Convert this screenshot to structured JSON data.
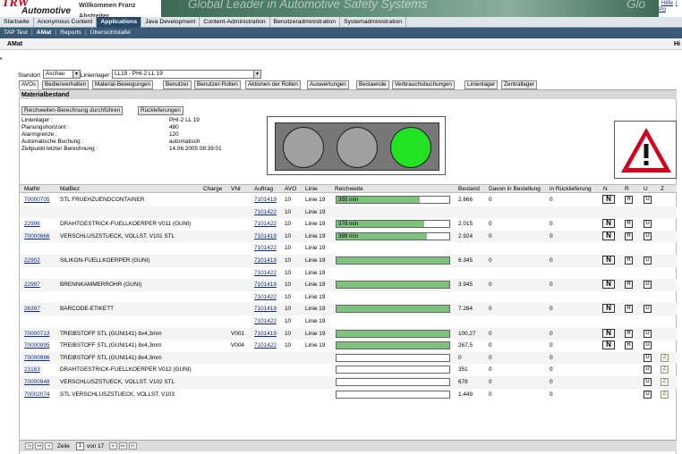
{
  "header": {
    "logo_text": "TRW",
    "logo_sub": "Automotive",
    "welcome": "Willkommen Franz Abstreiter",
    "banner": "Global Leader in Automotive Safety Systems",
    "banner_tail": "Glo",
    "links": [
      "Hilfe",
      "| Po"
    ]
  },
  "nav1": [
    "Startseite",
    "Anonymous Content",
    "Applications",
    "Java Development",
    "Content-Administration",
    "Benutzeradministration",
    "Systemadministration"
  ],
  "nav2": [
    "TAP Test",
    "AMat",
    "Reports",
    "Übersichtstafel"
  ],
  "subheader": {
    "title": "AMat",
    "right": "Hi"
  },
  "filters": {
    "standort_label": "Standort",
    "standort_value": "Aschau",
    "linienlager_label": "Linienlager",
    "linienlager_value": "LL19 - PHI-2 LL 19"
  },
  "tabs": [
    "AVOs",
    "Bedienverhalten",
    "Material-Bewegungen",
    "Benutzer",
    "Benutzer-Rollen",
    "Aktionen der Rollen",
    "Auswertungen",
    "Bestaende",
    "Verbrauchsbuchungen",
    "Linienlager",
    "Zentrallager"
  ],
  "section_title": "Materialbestand",
  "buttons": {
    "reichweite": "Reichweiten-Berechnung durchführen",
    "rueck": "Rückleferungen"
  },
  "info": [
    {
      "k": "Linienlager :",
      "v": "PHI-2 LL 19"
    },
    {
      "k": "Planungshorizont :",
      "v": "480"
    },
    {
      "k": "Alarmgrenze :",
      "v": "120"
    },
    {
      "k": "Automatische Buchung :",
      "v": "automatisch"
    },
    {
      "k": "Zeitpunkt letzter Berechnung :",
      "v": "14.06.2005 08:39:01"
    }
  ],
  "table": {
    "headers": [
      "MatNr",
      "MatBez",
      "Charge",
      "VNr",
      "Auftrag",
      "AVO",
      "Linie",
      "Reichweite",
      "Bestand",
      "Davon in Bestellung",
      "in Rücklieferung",
      "N",
      "R",
      "U",
      "Z"
    ],
    "rows": [
      {
        "matnr": "70000705",
        "matbez": "STL FRUEHZUENDCONTAINER",
        "vnr": "",
        "auftrag": "7101419",
        "avo": "10",
        "linie": "Linie 19",
        "bar": "355 min",
        "fill": 0.74,
        "bestand": "2.666",
        "best": "0",
        "rueck": "0",
        "n": true,
        "r": true,
        "u": true,
        "z": false
      },
      {
        "matnr": "",
        "matbez": "",
        "vnr": "",
        "auftrag": "7101422",
        "avo": "10",
        "linie": "Linie 19",
        "bar": null,
        "fill": 0,
        "bestand": "",
        "best": "",
        "rueck": "",
        "n": false,
        "r": false,
        "u": false,
        "z": false
      },
      {
        "matnr": "22996",
        "matbez": "DRAHTGESTRICK-FUELLKOERPER V011 (GUNI)",
        "vnr": "",
        "auftrag": "7101422",
        "avo": "10",
        "linie": "Linie 19",
        "bar": "378 min",
        "fill": 0.78,
        "bestand": "2.015",
        "best": "0",
        "rueck": "0",
        "n": true,
        "r": true,
        "u": true,
        "z": false
      },
      {
        "matnr": "70000666",
        "matbez": "VERSCHLUSZSTUECK, VOLLST. V101 STL",
        "vnr": "",
        "auftrag": "7101419",
        "avo": "10",
        "linie": "Linie 19",
        "bar": "389 min",
        "fill": 0.8,
        "bestand": "2.924",
        "best": "0",
        "rueck": "0",
        "n": true,
        "r": true,
        "u": true,
        "z": false
      },
      {
        "matnr": "",
        "matbez": "",
        "vnr": "",
        "auftrag": "7101422",
        "avo": "10",
        "linie": "Linie 19",
        "bar": null,
        "fill": 0,
        "bestand": "",
        "best": "",
        "rueck": "",
        "n": false,
        "r": false,
        "u": false,
        "z": false
      },
      {
        "matnr": "22902",
        "matbez": "SILIKON-FUELLKOERPER (GUNI)",
        "vnr": "",
        "auftrag": "7101419",
        "avo": "10",
        "linie": "Linie 19",
        "bar": "",
        "fill": 1,
        "bestand": "6.345",
        "best": "0",
        "rueck": "0",
        "n": true,
        "r": true,
        "u": true,
        "z": false
      },
      {
        "matnr": "",
        "matbez": "",
        "vnr": "",
        "auftrag": "7101422",
        "avo": "10",
        "linie": "Linie 19",
        "bar": null,
        "fill": 0,
        "bestand": "",
        "best": "",
        "rueck": "",
        "n": false,
        "r": false,
        "u": false,
        "z": false
      },
      {
        "matnr": "22997",
        "matbez": "BRENNKAMMERROHR (GUNI)",
        "vnr": "",
        "auftrag": "7101419",
        "avo": "10",
        "linie": "Linie 19",
        "bar": "",
        "fill": 1,
        "bestand": "3.945",
        "best": "0",
        "rueck": "0",
        "n": true,
        "r": true,
        "u": true,
        "z": false
      },
      {
        "matnr": "",
        "matbez": "",
        "vnr": "",
        "auftrag": "7101422",
        "avo": "10",
        "linie": "Linie 19",
        "bar": null,
        "fill": 0,
        "bestand": "",
        "best": "",
        "rueck": "",
        "n": false,
        "r": false,
        "u": false,
        "z": false
      },
      {
        "matnr": "26397",
        "matbez": "BARCODE-ETIKETT",
        "vnr": "",
        "auftrag": "7101419",
        "avo": "10",
        "linie": "Linie 19",
        "bar": "",
        "fill": 1,
        "bestand": "7.264",
        "best": "0",
        "rueck": "0",
        "n": true,
        "r": true,
        "u": true,
        "z": false
      },
      {
        "matnr": "",
        "matbez": "",
        "vnr": "",
        "auftrag": "7101422",
        "avo": "10",
        "linie": "Linie 19",
        "bar": null,
        "fill": 0,
        "bestand": "",
        "best": "",
        "rueck": "",
        "n": false,
        "r": false,
        "u": false,
        "z": false
      },
      {
        "matnr": "70000713",
        "matbez": "TREIBSTOFF STL (GUNI141) 8x4,3mm",
        "vnr": "V001",
        "auftrag": "7101419",
        "avo": "10",
        "linie": "Linie 19",
        "bar": "",
        "fill": 1,
        "bestand": "100,27",
        "best": "0",
        "rueck": "0",
        "n": true,
        "r": true,
        "u": true,
        "z": false
      },
      {
        "matnr": "70000995",
        "matbez": "TREIBSTOFF STL (GUNI141) 8x4,3mm",
        "vnr": "V004",
        "auftrag": "7101422",
        "avo": "10",
        "linie": "Linie 19",
        "bar": "",
        "fill": 1,
        "bestand": "267,5",
        "best": "0",
        "rueck": "0",
        "n": true,
        "r": true,
        "u": true,
        "z": false
      },
      {
        "matnr": "70000996",
        "matbez": "TREIBSTOFF STL (GUNI141) 8x4,3mm",
        "vnr": "",
        "auftrag": "",
        "avo": "",
        "linie": "",
        "bar": "",
        "fill": 0,
        "bestand": "0",
        "best": "0",
        "rueck": "0",
        "n": false,
        "r": false,
        "u": true,
        "z": true
      },
      {
        "matnr": "23163",
        "matbez": "DRAHTGESTRICK-FUELLKOERPER V012 (GUNI)",
        "vnr": "",
        "auftrag": "",
        "avo": "",
        "linie": "",
        "bar": "",
        "fill": 0,
        "bestand": "351",
        "best": "0",
        "rueck": "0",
        "n": false,
        "r": false,
        "u": true,
        "z": true
      },
      {
        "matnr": "70000948",
        "matbez": "VERSCHLUSZSTUECK, VOLLST. V102 STL",
        "vnr": "",
        "auftrag": "",
        "avo": "",
        "linie": "",
        "bar": "",
        "fill": 0,
        "bestand": "678",
        "best": "0",
        "rueck": "0",
        "n": false,
        "r": false,
        "u": true,
        "z": true
      },
      {
        "matnr": "70002074",
        "matbez": "STL VERSCHLUSZSTUECK, VOLLST. V103",
        "vnr": "",
        "auftrag": "",
        "avo": "",
        "linie": "",
        "bar": "",
        "fill": 0,
        "bestand": "1.449",
        "best": "0",
        "rueck": "0",
        "n": false,
        "r": false,
        "u": true,
        "z": true
      }
    ]
  },
  "pager": {
    "zeile_label": "Zeile",
    "page": "1",
    "von_label": "von 17"
  },
  "colors": {
    "bar_fill": "#7ec27e",
    "lamp_green": "#22e322",
    "nav_active": "#2a4a6a",
    "link": "#0a2a9a"
  },
  "icons": {
    "warning": "warning-triangle-icon"
  }
}
